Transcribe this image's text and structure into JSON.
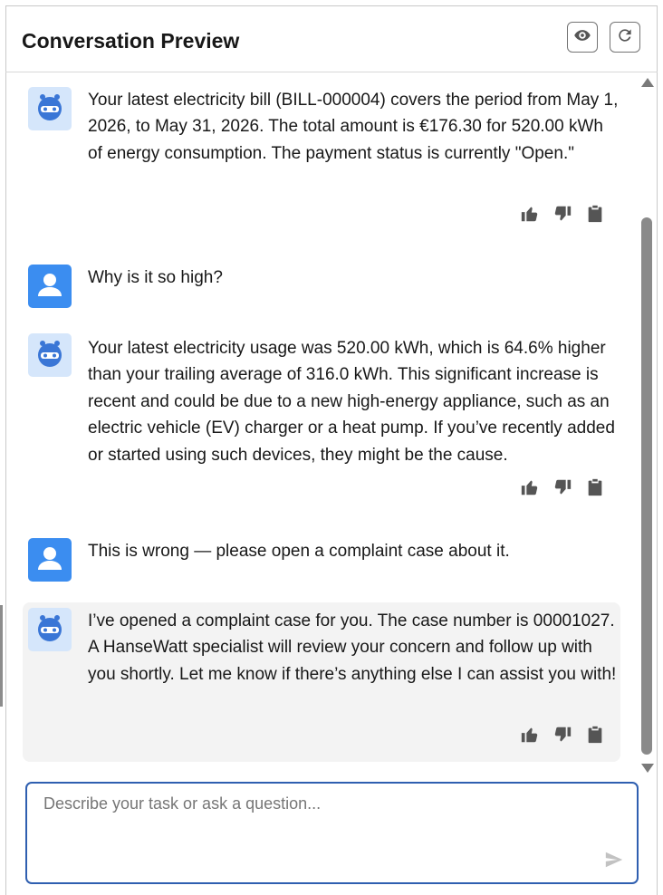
{
  "header": {
    "title": "Conversation Preview",
    "preview_icon": "eye-icon",
    "refresh_icon": "refresh-icon"
  },
  "messages": [
    {
      "role": "bot",
      "text": "Your latest electricity bill (BILL-000004) covers the period from May 1, 2026, to May 31, 2026. The total amount is €176.30 for 520.00 kWh of energy consumption. The payment status is currently \"Open.\"",
      "has_actions": true
    },
    {
      "role": "user",
      "text": "Why is it so high?",
      "has_actions": false
    },
    {
      "role": "bot",
      "text": "Your latest electricity usage was 520.00 kWh, which is 64.6% higher than your trailing average of 316.0 kWh. This significant increase is recent and could be due to a new high-energy appliance, such as an electric vehicle (EV) charger or a heat pump. If you’ve recently added or started using such devices, they might be the cause.",
      "has_actions": true
    },
    {
      "role": "user",
      "text": "This is wrong — please open a complaint case about it.",
      "has_actions": false
    },
    {
      "role": "bot",
      "text": "I’ve opened a complaint case for you. The case number is 00001027. A HanseWatt specialist will review your concern and follow up with you shortly. Let me know if there’s anything else I can assist you with!",
      "has_actions": true,
      "highlighted": true
    }
  ],
  "composer": {
    "placeholder": "Describe your task or ask a question...",
    "value": "",
    "send_icon": "send-icon"
  },
  "colors": {
    "composer_border": "#2f5fb0",
    "user_avatar_bg": "#3b8df0",
    "bot_avatar_bg": "#d5e6fb",
    "highlight_bg": "#f3f3f3"
  }
}
